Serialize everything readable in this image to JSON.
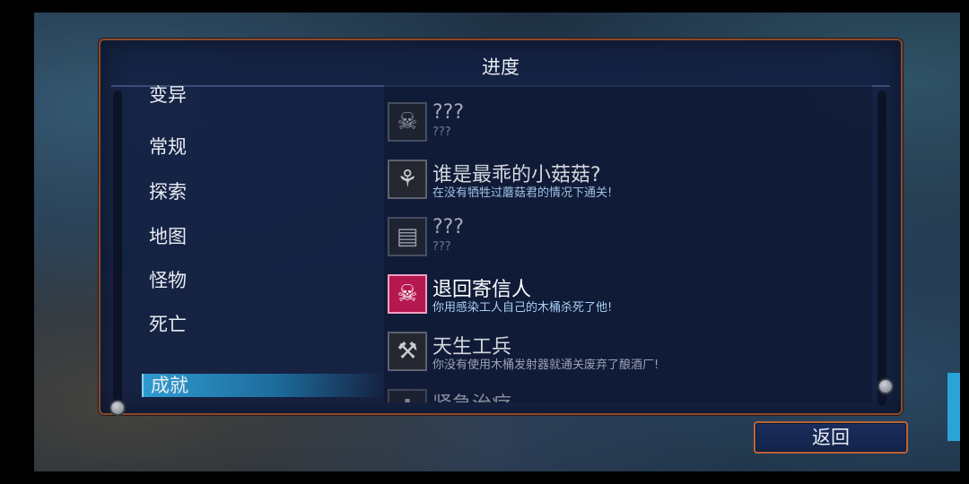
{
  "panel": {
    "title": "进度"
  },
  "categories": [
    {
      "label": "变异",
      "selected": false
    },
    {
      "label": "常规",
      "selected": false
    },
    {
      "label": "探索",
      "selected": false
    },
    {
      "label": "地图",
      "selected": false
    },
    {
      "label": "怪物",
      "selected": false
    },
    {
      "label": "死亡",
      "selected": false
    },
    {
      "label": "成就",
      "selected": true
    }
  ],
  "achievements": [
    {
      "title": "???",
      "desc": "???",
      "icon": "skull-cog-icon",
      "state": "locked"
    },
    {
      "title": "谁是最乖的小菇菇?",
      "desc": "在没有牺牲过蘑菇君的情况下通关!",
      "icon": "mushroom-icon",
      "state": "unlocked"
    },
    {
      "title": "???",
      "desc": "???",
      "icon": "scroll-icon",
      "state": "locked"
    },
    {
      "title": "退回寄信人",
      "desc": "你用感染工人自己的木桶杀死了他!",
      "icon": "skull-barrel-icon",
      "state": "selected"
    },
    {
      "title": "天生工兵",
      "desc": "你没有使用木桶发射器就通关废弃了酿酒厂!",
      "icon": "wrench-icon",
      "state": "unlocked"
    },
    {
      "title": "紧急治疗",
      "desc": "",
      "icon": "heal-icon",
      "state": "partial"
    }
  ],
  "footer": {
    "back_label": "返回"
  },
  "colors": {
    "panel_border": "#8a4a2e",
    "selected_category": "#2f9ad0",
    "highlight_icon": "#b5174f"
  }
}
